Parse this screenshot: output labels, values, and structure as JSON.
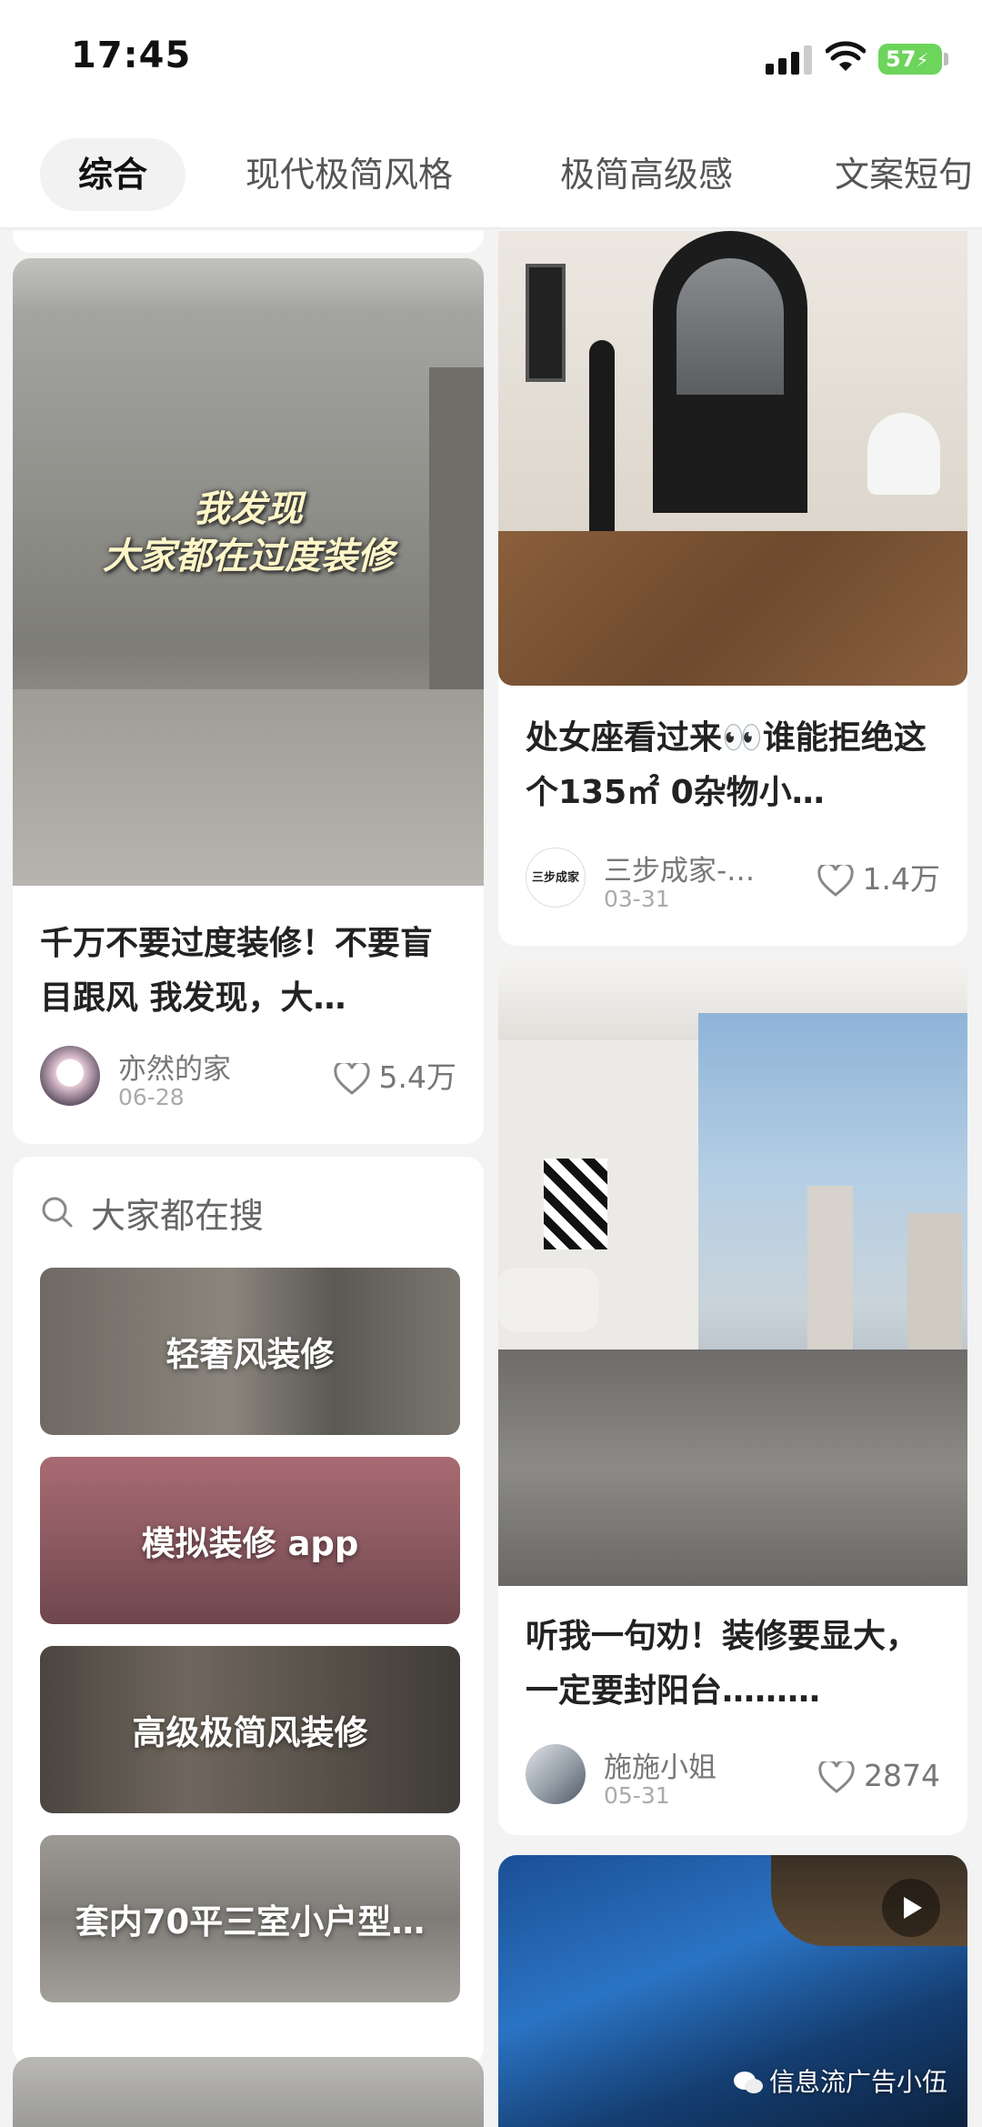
{
  "status_bar": {
    "time": "17:45",
    "battery": "57"
  },
  "tabs": [
    {
      "label": "综合",
      "active": true
    },
    {
      "label": "现代极简风格",
      "active": false
    },
    {
      "label": "极简高级感",
      "active": false
    },
    {
      "label": "文案短句",
      "active": false
    }
  ],
  "feed": {
    "card_left_1": {
      "image_overlay_line1": "我发现",
      "image_overlay_line2": "大家都在过度装修",
      "title": "千万不要过度装修！不要盲目跟风 我发现，大…",
      "author": "亦然的家",
      "date": "06-28",
      "likes": "5.4万"
    },
    "search_block": {
      "label": "大家都在搜",
      "items": [
        {
          "label": "轻奢风装修"
        },
        {
          "label": "模拟装修 app"
        },
        {
          "label": "高级极简风装修"
        },
        {
          "label": "套内70平三室小户型…"
        }
      ]
    },
    "card_right_1": {
      "title": "处女座看过来👀谁能拒绝这个135㎡ 0杂物小…",
      "author": "三步成家-…",
      "avatar_text": "三步成家",
      "date": "03-31",
      "likes": "1.4万"
    },
    "card_right_2": {
      "title": "听我一句劝！装修要显大，一定要封阳台………",
      "author": "施施小姐",
      "date": "05-31",
      "likes": "2874"
    },
    "card_right_3": {
      "has_video": true
    }
  },
  "watermark": "信息流广告小伍"
}
